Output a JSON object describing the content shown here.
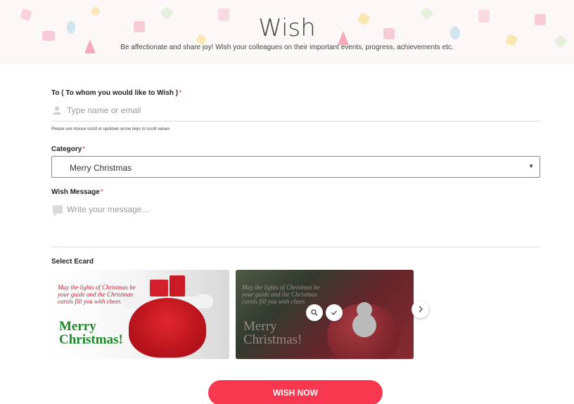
{
  "header": {
    "title": "Wish",
    "subtitle": "Be affectionate and share joy! Wish your colleagues on their important events, progress, achievements etc."
  },
  "to_field": {
    "label": "To ( To whom you would like to Wish )",
    "required_mark": "*",
    "placeholder": "Type name or email",
    "icon": "person-icon",
    "hint": "Please use mouse scroll or up/down arrow keys to scroll values"
  },
  "category": {
    "label": "Category",
    "required_mark": "*",
    "selected": "Merry Christmas",
    "caret": "▼"
  },
  "message": {
    "label": "Wish Message",
    "required_mark": "*",
    "placeholder": "Write your message...",
    "icon": "chat-bubble-icon"
  },
  "ecards": {
    "label": "Select Ecard",
    "cards": [
      {
        "verse": "May the lights of Christmas be your guide and the Christmas carols fill you with cheer.",
        "title": "Merry Christmas!"
      },
      {
        "verse": "May the lights of Christmas be your guide and the Christmas carols fill you with cheer.",
        "title": "Merry Christmas!"
      }
    ],
    "zoom_icon": "zoom-icon",
    "select_icon": "check-icon",
    "next_icon": "chevron-right-icon"
  },
  "submit": {
    "label": "WISH NOW"
  },
  "colors": {
    "accent": "#f8384f",
    "required": "#e53950",
    "card_title_green": "#1a8a24"
  }
}
